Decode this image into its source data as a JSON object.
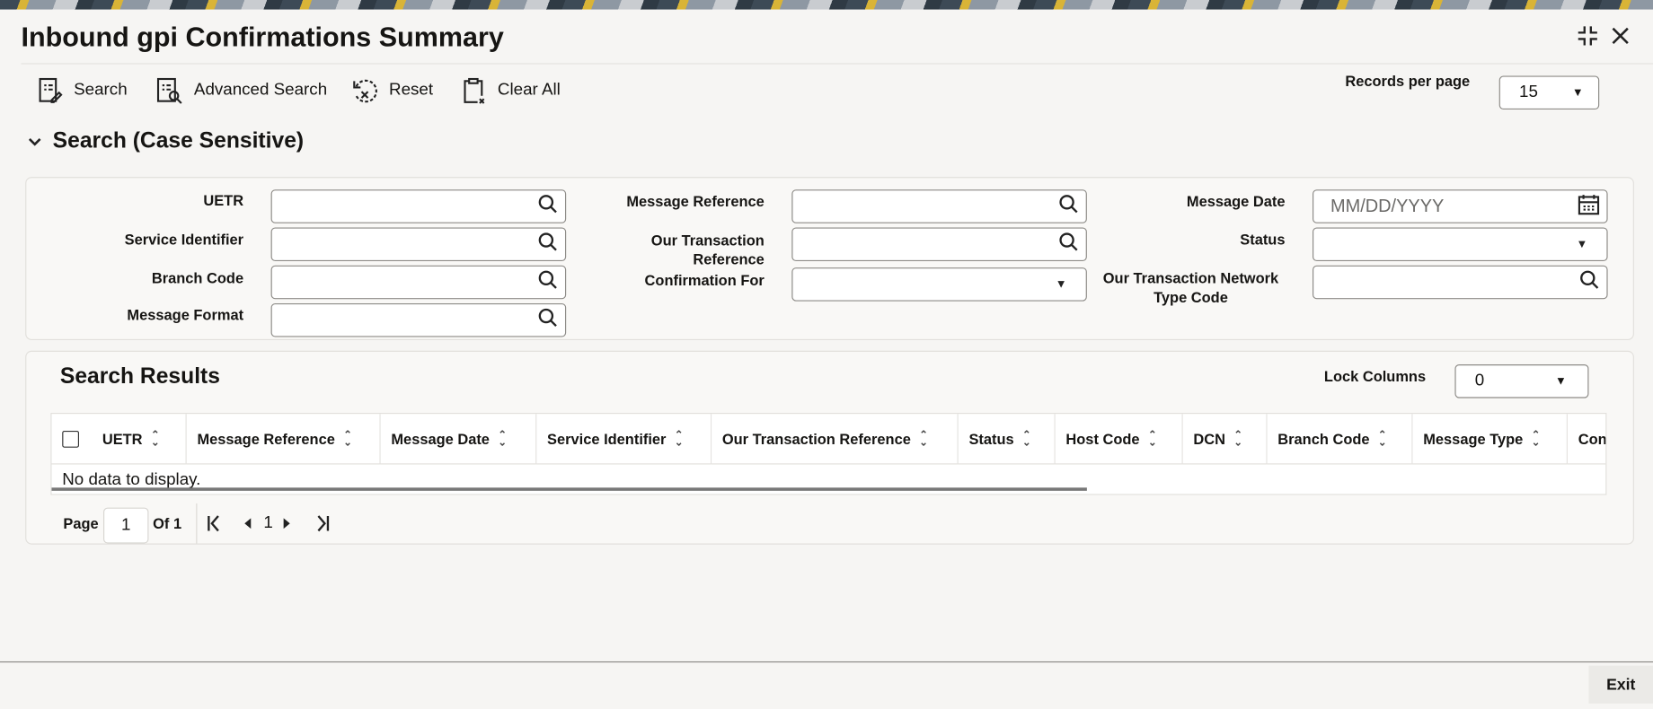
{
  "header": {
    "title": "Inbound gpi Confirmations Summary"
  },
  "toolbar": {
    "search": "Search",
    "advanced_search": "Advanced Search",
    "reset": "Reset",
    "clear_all": "Clear All",
    "records_per_page_label": "Records per page",
    "records_per_page_value": "15"
  },
  "search_section": {
    "title": "Search (Case Sensitive)",
    "fields": {
      "uetr": "UETR",
      "service_identifier": "Service Identifier",
      "branch_code": "Branch Code",
      "message_format": "Message Format",
      "message_reference": "Message Reference",
      "our_txn_ref": "Our Transaction Reference",
      "confirmation_for": "Confirmation For",
      "message_date": "Message Date",
      "message_date_placeholder": "MM/DD/YYYY",
      "status": "Status",
      "network_type_code": "Our Transaction Network Type Code"
    }
  },
  "results": {
    "title": "Search Results",
    "lock_columns_label": "Lock Columns",
    "lock_columns_value": "0",
    "columns": [
      "UETR",
      "Message Reference",
      "Message Date",
      "Service Identifier",
      "Our Transaction Reference",
      "Status",
      "Host Code",
      "DCN",
      "Branch Code",
      "Message Type",
      "Confirmation For"
    ],
    "empty_text": "No data to display.",
    "pagination": {
      "page_label": "Page",
      "page_value": "1",
      "of_label": "Of 1",
      "current": "1"
    }
  },
  "footer": {
    "exit": "Exit"
  }
}
